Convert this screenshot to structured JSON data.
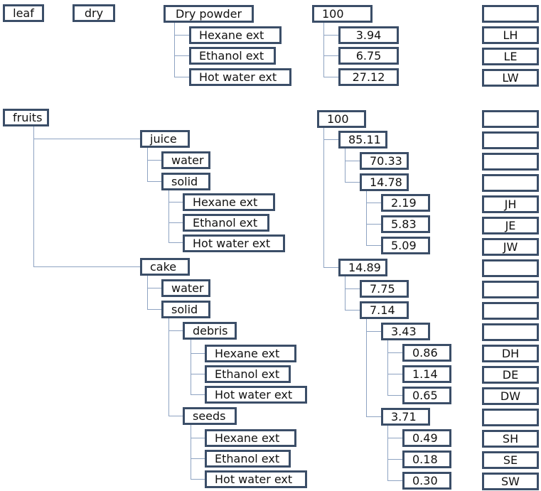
{
  "diagram": {
    "leaf_row": {
      "labels": [
        "leaf",
        "dry",
        "Dry powder",
        "Hexane ext",
        "Ethanol ext",
        "Hot water ext"
      ],
      "values": [
        "100",
        "3.94",
        "6.75",
        "27.12"
      ],
      "codes": [
        "",
        "LH",
        "LE",
        "LW"
      ]
    },
    "fruit_row": {
      "labels": [
        "fruits",
        "juice",
        "water",
        "solid",
        "Hexane ext",
        "Ethanol ext",
        "Hot water ext",
        "cake",
        "water",
        "solid",
        "debris",
        "Hexane ext",
        "Ethanol ext",
        "Hot water ext",
        "seeds",
        "Hexane ext",
        "Ethanol ext",
        "Hot water ext"
      ],
      "values": [
        "100",
        "85.11",
        "70.33",
        "14.78",
        "2.19",
        "5.83",
        "5.09",
        "14.89",
        "7.75",
        "7.14",
        "3.43",
        "0.86",
        "1.14",
        "0.65",
        "3.71",
        "0.49",
        "0.18",
        "0.30"
      ],
      "codes": [
        "",
        "",
        "",
        "",
        "JH",
        "JE",
        "JW",
        "",
        "",
        "",
        "",
        "DH",
        "DE",
        "DW",
        "",
        "SH",
        "SE",
        "SW"
      ]
    },
    "colors": {
      "box_border": "#3b4e68",
      "connector": "#8ea3c2"
    }
  }
}
